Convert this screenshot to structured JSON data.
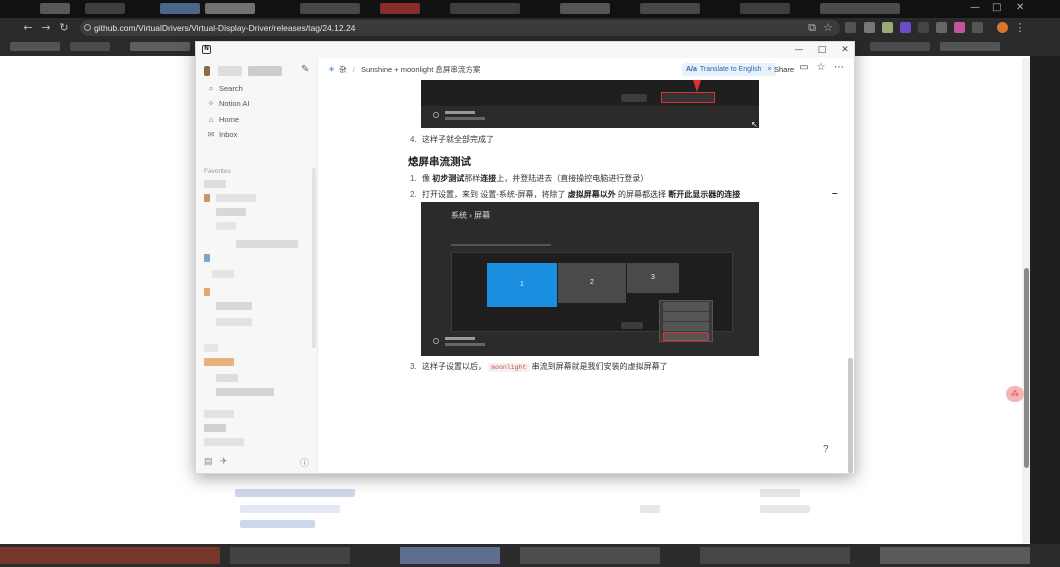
{
  "browser": {
    "url": "github.com/VirtualDrivers/Virtual-Display-Driver/releases/tag/24.12.24",
    "window_controls": [
      "—",
      "□",
      "✕"
    ]
  },
  "notion": {
    "sidebar": {
      "items": [
        {
          "icon": "search-icon",
          "glyph": "⌕",
          "label": "Search"
        },
        {
          "icon": "sparkle-icon",
          "glyph": "✧",
          "label": "Notion AI"
        },
        {
          "icon": "home-icon",
          "glyph": "⌂",
          "label": "Home"
        },
        {
          "icon": "inbox-icon",
          "glyph": "✉",
          "label": "Inbox"
        }
      ],
      "section_label": "Favorites"
    },
    "topbar": {
      "breadcrumb_sep": "/",
      "breadcrumb_icon": "杂",
      "breadcrumb_page": "Sunshine + moonlight 息屏串流方案",
      "translate_prefix": "A/a",
      "translate_label": "Translate to English",
      "share_label": "Share"
    },
    "content": {
      "step4": {
        "num": "4.",
        "text": "这样子就全部完成了"
      },
      "heading": "熄屏串流测试",
      "list1": {
        "num": "1.",
        "pre": "像",
        "b1": "初步测试",
        "mid": "那样",
        "b2": "连接",
        "post": "上，并登陆进去（直接操控电脑进行登录）"
      },
      "list2": {
        "num": "2.",
        "pre": "打开设置，来到 设置-系统-屏幕，将除了",
        "b1": "虚拟屏幕以外",
        "mid": "的屏幕都选择",
        "b2": "断开此显示器的连接"
      },
      "list3": {
        "num": "3.",
        "pre": "这样子设置以后，",
        "code": "moonlight",
        "post": "串流到屏幕就是我们安装的虚拟屏幕了"
      }
    },
    "screenshot": {
      "title": "系统  ›  屏幕",
      "monitors": [
        "1",
        "2",
        "3"
      ]
    },
    "help_glyph": "?"
  },
  "colors": {
    "accent": "#1a8fe0",
    "highlight_red": "#e03030"
  }
}
